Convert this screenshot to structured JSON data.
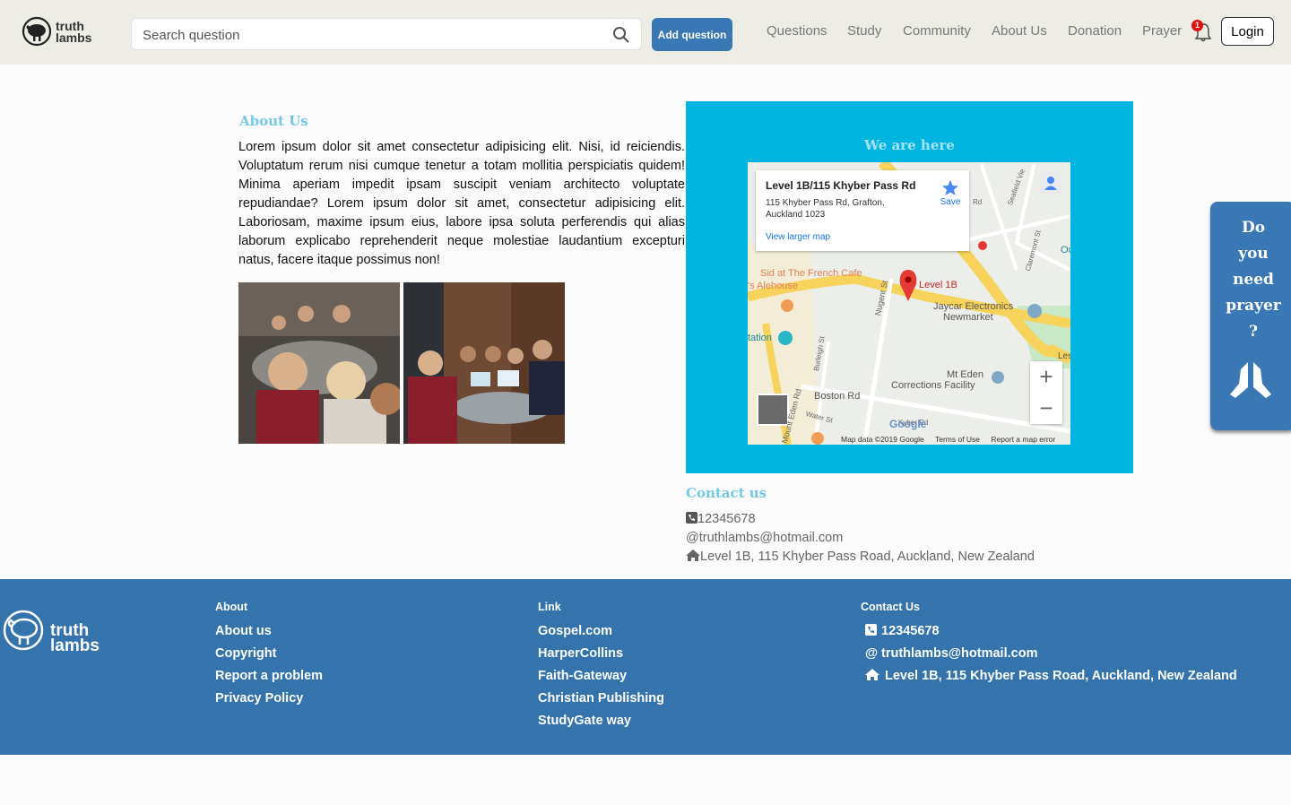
{
  "brand": {
    "name_line1": "truth",
    "name_line2": "lambs"
  },
  "search": {
    "placeholder": "Search question"
  },
  "header": {
    "add_question": "Add question",
    "nav": [
      "Questions",
      "Study",
      "Community",
      "About Us",
      "Donation",
      "Prayer"
    ],
    "notification_count": "1",
    "login": "Login"
  },
  "about": {
    "title": "About Us",
    "body": "Lorem ipsum dolor sit amet consectetur adipisicing elit. Nisi, id reiciendis. Voluptatum rerum nisi cumque tenetur a totam mollitia perspiciatis quidem! Minima aperiam impedit ipsam suscipit veniam architecto voluptate repudiandae? Lorem ipsum dolor sit amet, consectetur adipisicing elit. Laboriosam, maxime ipsum eius, labore ipsa soluta perferendis qui alias laborum explicabo reprehenderit neque molestiae laudantium excepturi natus, facere itaque possimus non!"
  },
  "map_panel": {
    "title": "We are here",
    "card_title": "Level 1B/115 Khyber Pass Rd",
    "card_address": "115 Khyber Pass Rd, Grafton, Auckland 1023",
    "card_link": "View larger map",
    "card_save": "Save",
    "marker_label": "Level 1B",
    "places": [
      "Sid at The French Cafe",
      "'s Alehouse",
      "Jaycar Electronics",
      "Newmarket",
      "Mt Eden",
      "Corrections Facility",
      "tation",
      "Boston Rd",
      "Nugent St",
      "Mount Eden Rd",
      "Burleigh St",
      "Water St",
      "Claremont St",
      "Seafield Vie",
      "Ou",
      "Les",
      "Kyber Rd",
      "Rd"
    ],
    "footer": [
      "Map data ©2019 Google",
      "Terms of Use",
      "Report a map error"
    ],
    "google": "Google"
  },
  "contact": {
    "title": "Contact us",
    "phone": "12345678",
    "email": "truthlambs@hotmail.com",
    "address": "Level 1B, 115 Khyber Pass Road, Auckland, New Zealand"
  },
  "prayer_widget": {
    "lines": [
      "Do",
      "you",
      "need",
      "prayer",
      "?"
    ]
  },
  "footer": {
    "about": {
      "heading": "About",
      "links": [
        "About us",
        "Copyright",
        "Report a problem",
        "Privacy Policy"
      ]
    },
    "link": {
      "heading": "Link",
      "links": [
        "Gospel.com",
        "HarperCollins",
        "Faith-Gateway",
        "Christian Publishing",
        "StudyGate way"
      ]
    },
    "contact": {
      "heading": "Contact Us",
      "phone": "12345678",
      "email": "truthlambs@hotmail.com",
      "address": "Level 1B, 115 Khyber Pass Road, Auckland, New Zealand"
    }
  }
}
